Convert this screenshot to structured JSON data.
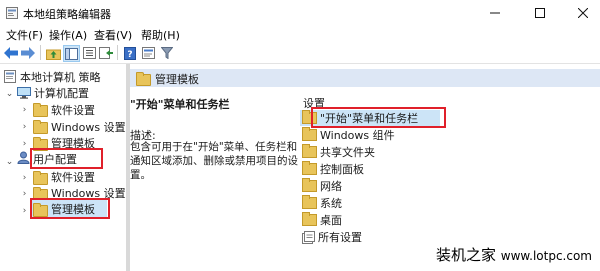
{
  "window": {
    "title": "本地组策略编辑器"
  },
  "menu": {
    "file": "文件(F)",
    "action": "操作(A)",
    "view": "查看(V)",
    "help": "帮助(H)"
  },
  "tree": {
    "root": "本地计算机 策略",
    "computer_config": "计算机配置",
    "cc_items": [
      "软件设置",
      "Windows 设置",
      "管理模板"
    ],
    "user_config": "用户配置",
    "uc_items": [
      "软件设置",
      "Windows 设置",
      "管理模板"
    ]
  },
  "right": {
    "header": "管理模板",
    "desc_title": "\"开始\"菜单和任务栏",
    "desc_label": "描述:",
    "desc_body": "包含可用于在\"开始\"菜单、任务栏和通知区域添加、删除或禁用项目的设置。",
    "settings_heading": "设置",
    "settings": [
      "\"开始\"菜单和任务栏",
      "Windows 组件",
      "共享文件夹",
      "控制面板",
      "网络",
      "系统",
      "桌面",
      "所有设置"
    ]
  },
  "watermark": {
    "cn": "装机之家",
    "url": "www.lotpc.com"
  }
}
